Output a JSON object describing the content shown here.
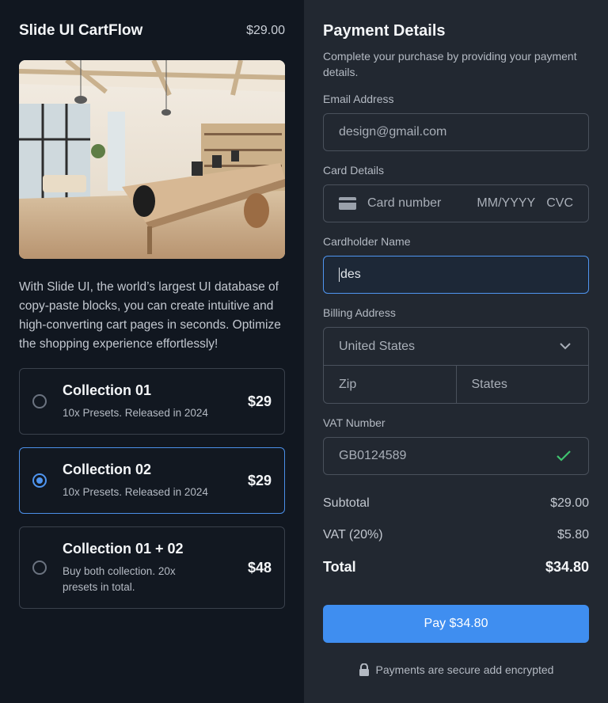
{
  "product": {
    "title": "Slide UI CartFlow",
    "price": "$29.00",
    "description": "With Slide UI, the world’s largest UI database of copy-paste blocks, you can create intuitive and high-converting cart pages in seconds. Optimize the shopping experience effortlessly!"
  },
  "options": [
    {
      "name": "Collection 01",
      "subtitle": "10x Presets. Released in 2024",
      "price": "$29",
      "selected": false
    },
    {
      "name": "Collection 02",
      "subtitle": "10x Presets. Released in 2024",
      "price": "$29",
      "selected": true
    },
    {
      "name": "Collection 01 + 02",
      "subtitle": "Buy both collection. 20x presets in total.",
      "price": "$48",
      "selected": false
    }
  ],
  "payment": {
    "title": "Payment Details",
    "subtitle": "Complete your purchase by providing your payment details.",
    "email_label": "Email Address",
    "email_value": "design@gmail.com",
    "card_label": "Card Details",
    "card_number_placeholder": "Card number",
    "card_expiry_placeholder": "MM/YYYY",
    "card_cvc_placeholder": "CVC",
    "cardholder_label": "Cardholder Name",
    "cardholder_value": "des",
    "billing_label": "Billing Address",
    "country": "United States",
    "zip_placeholder": "Zip",
    "state_placeholder": "States",
    "vat_label": "VAT Number",
    "vat_value": "GB0124589"
  },
  "summary": {
    "subtotal_label": "Subtotal",
    "subtotal_value": "$29.00",
    "vat_label": "VAT (20%)",
    "vat_value": "$5.80",
    "total_label": "Total",
    "total_value": "$34.80"
  },
  "pay_button": "Pay $34.80",
  "secure_note": "Payments are secure add encrypted",
  "colors": {
    "accent": "#3f8ef0",
    "check": "#3fc46f"
  }
}
